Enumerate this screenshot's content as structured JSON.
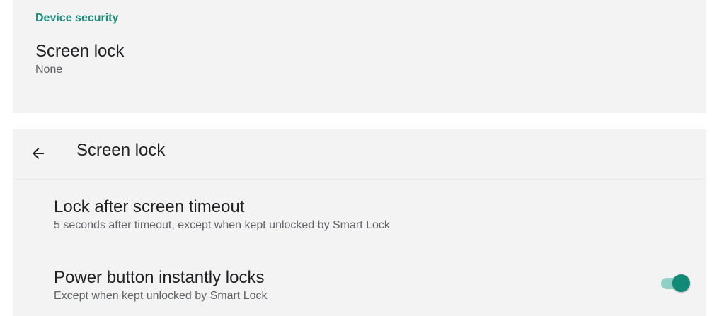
{
  "device_security": {
    "section_header": "Device security",
    "screen_lock": {
      "title": "Screen lock",
      "summary": "None"
    }
  },
  "screen_lock_page": {
    "toolbar": {
      "back_icon": "arrow-back-icon",
      "title": "Screen lock"
    },
    "items": [
      {
        "title": "Lock after screen timeout",
        "summary": "5 seconds after timeout, except when kept unlocked by Smart Lock"
      },
      {
        "title": "Power button instantly locks",
        "summary": "Except when kept unlocked by Smart Lock",
        "toggle_on": true
      }
    ]
  },
  "colors": {
    "accent": "#1a8c7c",
    "toggle_track": "#8fcfc5",
    "toggle_thumb": "#128a78",
    "panel_bg": "#f3f3f3"
  }
}
